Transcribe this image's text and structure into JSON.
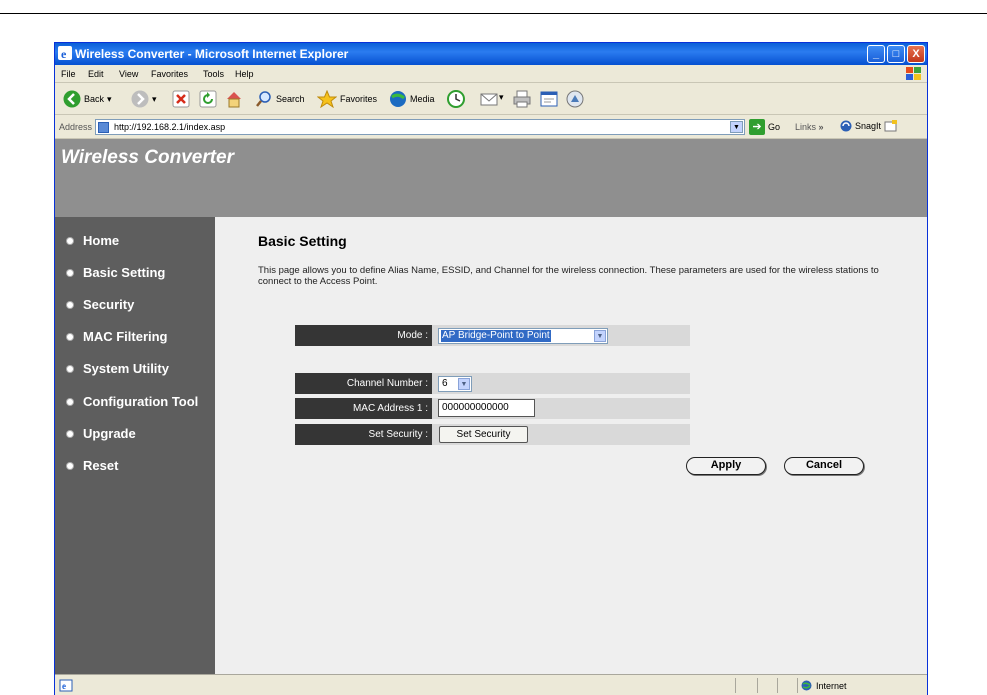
{
  "window": {
    "title": "Wireless Converter - Microsoft Internet Explorer",
    "controls": {
      "minimize": "_",
      "maximize": "□",
      "close": "X"
    }
  },
  "menu": [
    "File",
    "Edit",
    "View",
    "Favorites",
    "Tools",
    "Help"
  ],
  "toolbar": {
    "back": "Back",
    "search": "Search",
    "favorites": "Favorites",
    "media": "Media"
  },
  "address": {
    "label": "Address",
    "url": "http://192.168.2.1/index.asp",
    "go": "Go",
    "links": "Links",
    "snagit": "SnagIt"
  },
  "banner": {
    "brand": "Wireless Converter"
  },
  "nav": [
    {
      "label": "Home"
    },
    {
      "label": "Basic Setting"
    },
    {
      "label": "Security"
    },
    {
      "label": "MAC Filtering"
    },
    {
      "label": "System Utility"
    },
    {
      "label": "Configuration Tool"
    },
    {
      "label": "Upgrade"
    },
    {
      "label": "Reset"
    }
  ],
  "main": {
    "title": "Basic Setting",
    "description": "This page allows you to define Alias Name, ESSID, and Channel for the wireless connection. These parameters are used for the wireless stations to connect to the Access Point.",
    "form": {
      "mode_label": "Mode :",
      "mode_value": "AP Bridge-Point to Point",
      "channel_label": "Channel Number :",
      "channel_value": "6",
      "mac_label": "MAC Address 1 :",
      "mac_value": "000000000000",
      "security_label": "Set Security :",
      "security_button": "Set Security"
    },
    "apply": "Apply",
    "cancel": "Cancel"
  },
  "status": {
    "zone": "Internet"
  }
}
